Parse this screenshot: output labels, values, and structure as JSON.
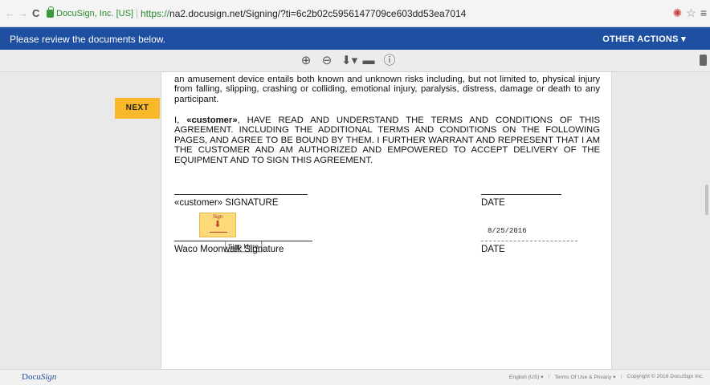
{
  "browser": {
    "ev_name": "DocuSign, Inc. [US]",
    "url_scheme": "https://",
    "url_rest": "na2.docusign.net/Signing/?ti=6c2b02c5956147709ce603dd53ea7014",
    "icons": [
      "back-icon",
      "forward-icon",
      "reload-icon",
      "lock-icon",
      "extension-icon",
      "star-icon",
      "menu-icon"
    ]
  },
  "header": {
    "message": "Please review the documents below.",
    "other_actions": "OTHER ACTIONS ▾"
  },
  "toolbar": {
    "icons": [
      "zoom-in-icon",
      "zoom-out-icon",
      "download-icon",
      "print-icon",
      "help-icon"
    ]
  },
  "document": {
    "paragraph1": "an amusement device entails both known and unknown risks including, but not limited to, physical injury from falling, slipping, crashing or colliding, emotional injury, paralysis, distress, damage or death to any participant.",
    "paragraph2_prefix": "I, ",
    "paragraph2_customer": "«customer»",
    "paragraph2_rest": ", HAVE READ AND UNDERSTAND THE TERMS AND CONDITIONS OF THIS AGREEMENT. INCLUDING THE ADDITIONAL TERMS AND CONDITIONS ON THE FOLLOWING PAGES, AND AGREE TO BE BOUND BY THEM. I FURTHER WARRANT AND REPRESENT THAT I AM THE CUSTOMER AND AM AUTHORIZED AND EMPOWERED TO ACCEPT DELIVERY OF THE EQUIPMENT AND TO SIGN THIS AGREEMENT.",
    "customer_signature_label": "«customer» SIGNATURE",
    "date_label_1": "DATE",
    "sign_tab_label": "Sign",
    "tooltip": "Sign Here",
    "date_value": "8/25/2016",
    "company_signature_label": "Waco Moonwalk Signature",
    "date_label_2": "DATE"
  },
  "next_button": "NEXT",
  "footer": {
    "logo_prefix": "Docu",
    "logo_suffix": "Sign",
    "language": "English (US) ▾",
    "terms": "Terms Of Use & Privacy ▾",
    "copyright": "Copyright © 2016 DocuSign Inc."
  },
  "colors": {
    "header_blue": "#1f4fa1",
    "next_yellow": "#f8b829",
    "sign_tab_yellow": "#fcd979"
  }
}
